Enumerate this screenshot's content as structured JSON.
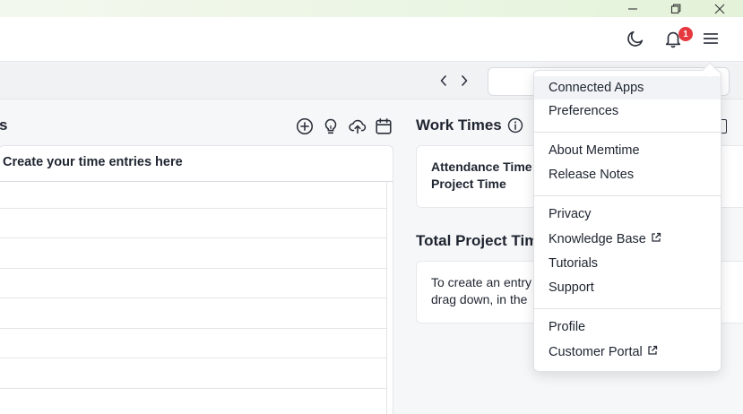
{
  "sections": {
    "entries_title_fragment": "s",
    "entries_header": "Create your time entries here",
    "work_times_title": "Work Times",
    "total_project_title": "Total Project Tim"
  },
  "notifications": {
    "count": "1"
  },
  "work_times_card": {
    "attendance_label": "Attendance Time",
    "project_label": "Project Time"
  },
  "total_project_card": {
    "line1": "To create an entry",
    "line2": "drag down, in the"
  },
  "menu": {
    "items": [
      {
        "label": "Connected Apps",
        "external": false,
        "active": true
      },
      {
        "label": "Preferences",
        "external": false
      },
      {
        "label": "About Memtime",
        "external": false
      },
      {
        "label": "Release Notes",
        "external": false
      },
      {
        "label": "Privacy",
        "external": false
      },
      {
        "label": "Knowledge Base",
        "external": true
      },
      {
        "label": "Tutorials",
        "external": false
      },
      {
        "label": "Support",
        "external": false
      },
      {
        "label": "Profile",
        "external": false
      },
      {
        "label": "Customer Portal",
        "external": true
      }
    ]
  },
  "icons": {
    "titlebar": [
      "minimize-icon",
      "restore-icon",
      "close-icon"
    ],
    "appbar": [
      "moon-icon",
      "bell-icon",
      "hamburger-menu-icon"
    ],
    "toolbar": [
      "chevron-left-icon",
      "chevron-right-icon"
    ],
    "entries_tools": [
      "add-circle-icon",
      "lightbulb-icon",
      "cloud-upload-icon",
      "calendar-icon"
    ],
    "work_times": [
      "info-icon"
    ]
  },
  "colors": {
    "badge": "#e5393f",
    "titlebar_tint": "#e3f2d9",
    "active_menu_item": "#f1f3f6"
  }
}
